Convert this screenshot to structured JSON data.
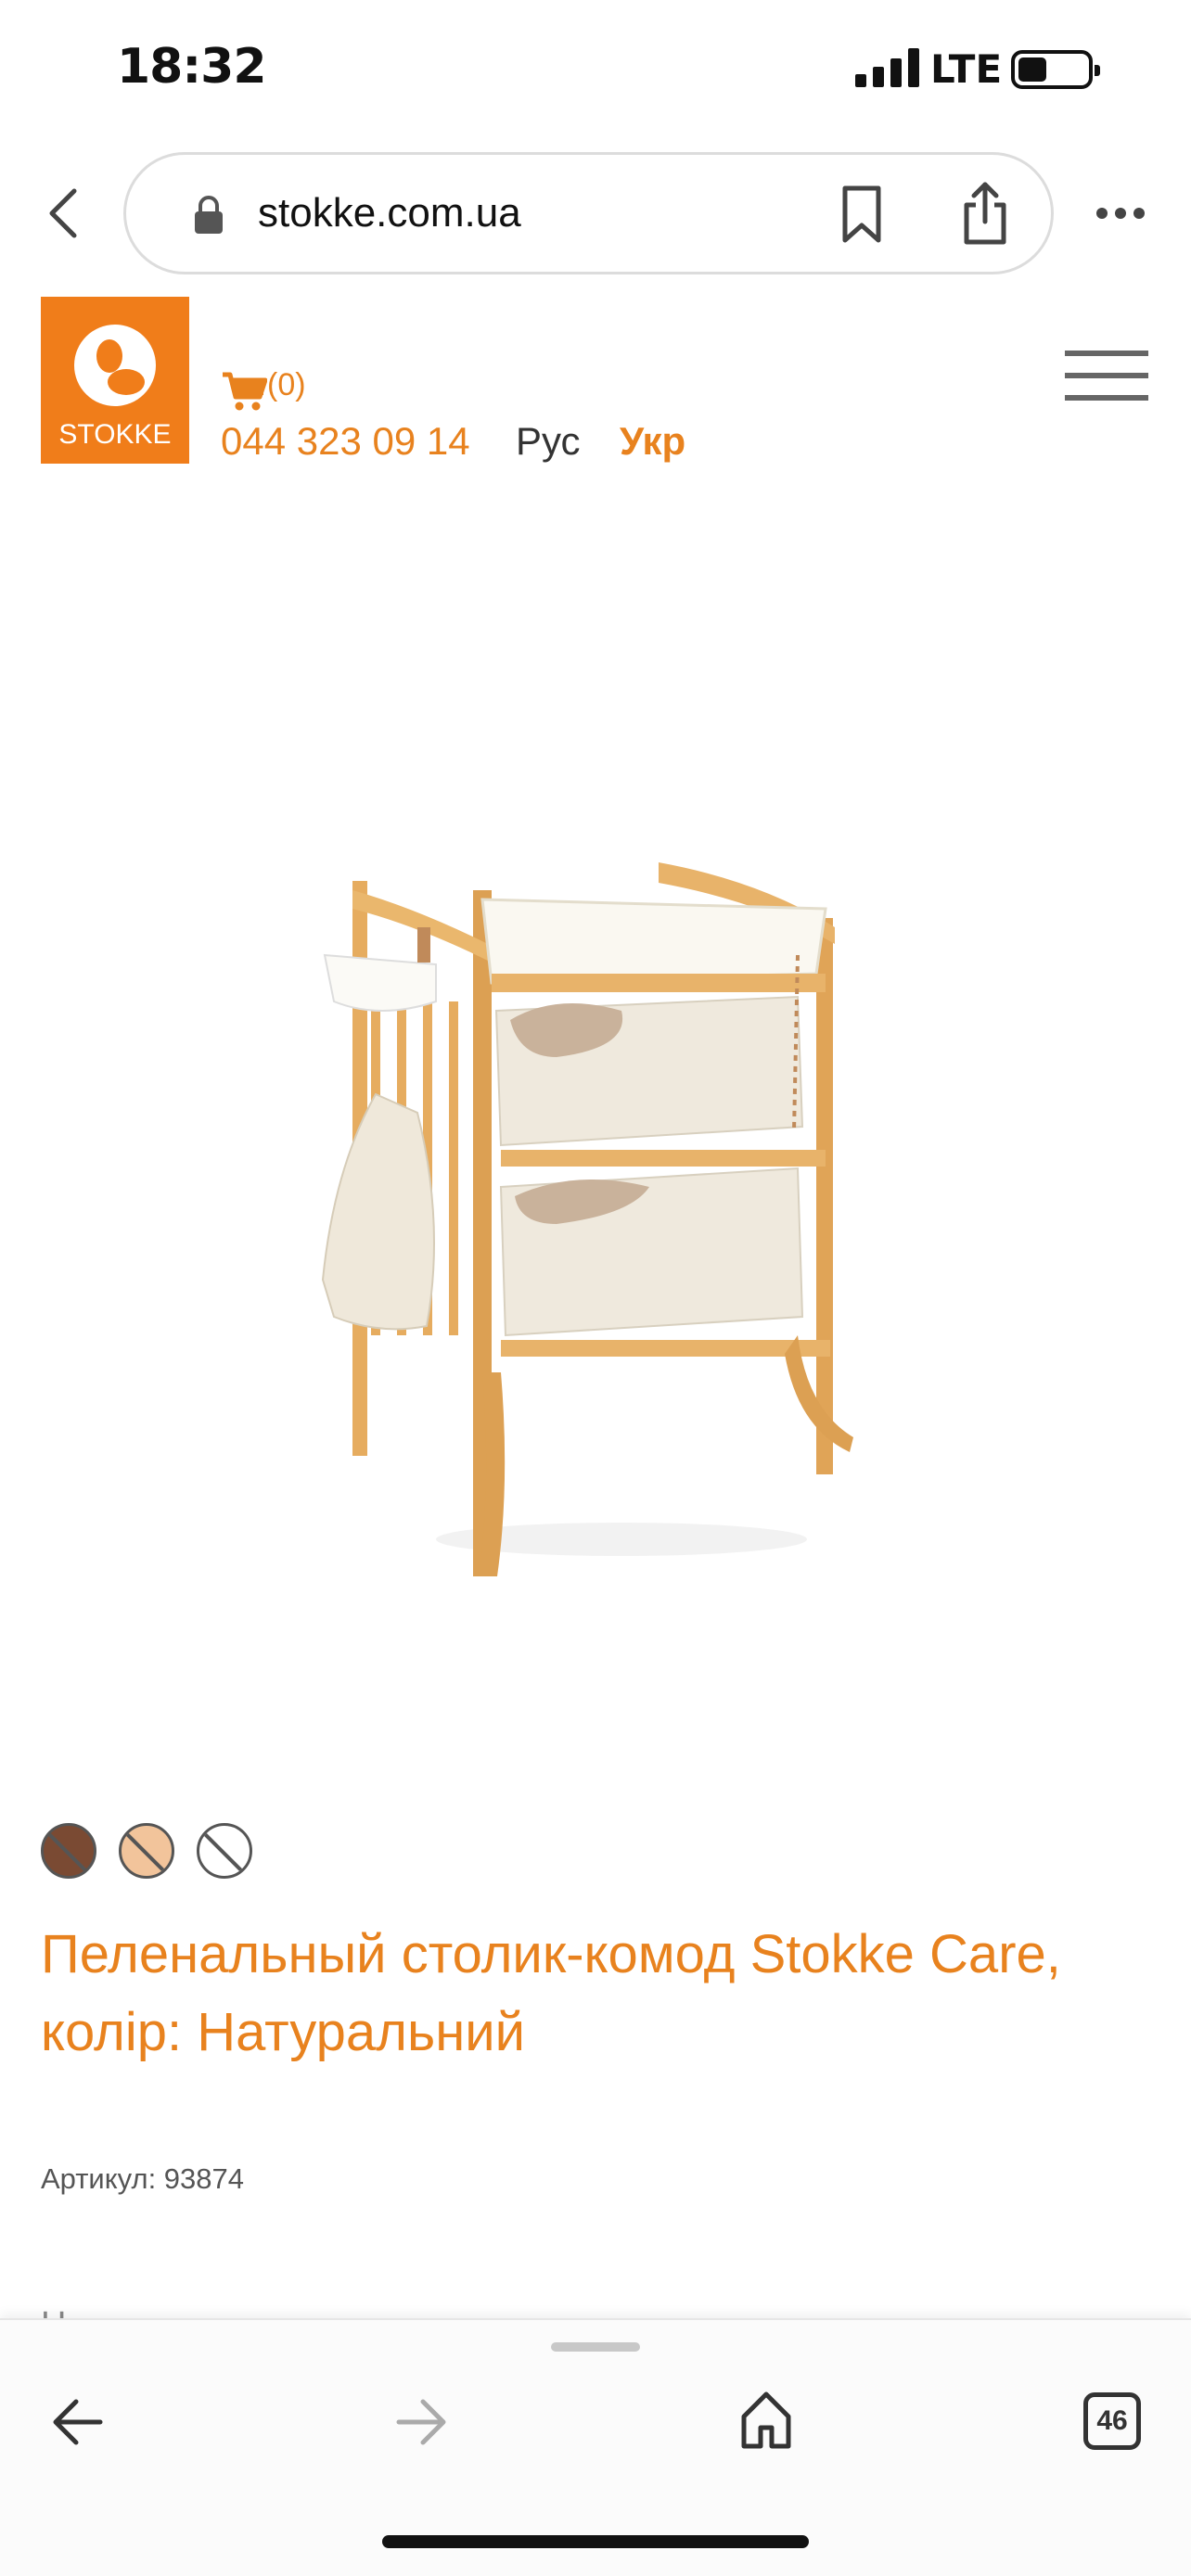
{
  "status": {
    "time": "18:32",
    "network": "LTE"
  },
  "browser": {
    "url": "stokke.com.ua",
    "tabs_count": "46"
  },
  "header": {
    "logo_text": "STOKKE",
    "cart_count": "(0)",
    "phone": "044 323 09 14",
    "lang_ru": "Рус",
    "lang_uk": "Укр"
  },
  "product": {
    "title": "Пеленальный столик-комод Stokke Care, колір: Натуральний",
    "sku": "Артикул: 93874",
    "colors": [
      "#7a4a33",
      "#f2c49b",
      "#ffffff"
    ],
    "next_text_partial": "Н"
  },
  "colors": {
    "accent": "#e8821e",
    "logo_bg": "#f07d1a"
  },
  "icons": [
    "back-chevron-icon",
    "lock-icon",
    "bookmark-icon",
    "share-icon",
    "more-icon",
    "cart-icon",
    "hamburger-icon",
    "home-icon",
    "tabs-icon"
  ]
}
